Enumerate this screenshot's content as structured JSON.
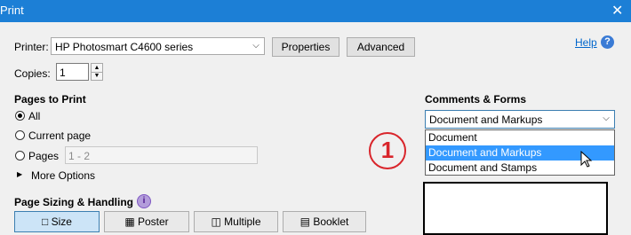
{
  "window": {
    "title": "Print",
    "close_glyph": "✕"
  },
  "printer": {
    "label": "Printer:",
    "value": "HP Photosmart C4600 series",
    "properties_label": "Properties",
    "advanced_label": "Advanced"
  },
  "help": {
    "label": "Help",
    "icon_glyph": "?"
  },
  "copies": {
    "label": "Copies:",
    "value": "1"
  },
  "pages_to_print": {
    "heading": "Pages to Print",
    "all_label": "All",
    "current_label": "Current page",
    "pages_label": "Pages",
    "pages_value": "1 - 2",
    "more_options_label": "More Options"
  },
  "comments_forms": {
    "heading": "Comments & Forms",
    "selected": "Document and Markups",
    "options": [
      "Document",
      "Document and Markups",
      "Document and Stamps"
    ]
  },
  "annotation": {
    "number": "1",
    "color": "#d9252b"
  },
  "page_sizing": {
    "heading": "Page Sizing & Handling",
    "info_glyph": "i",
    "tabs": [
      "Size",
      "Poster",
      "Multiple",
      "Booklet"
    ]
  },
  "colors": {
    "titlebar": "#1c7fd6",
    "selection": "#3399ff",
    "link": "#0066cc"
  }
}
